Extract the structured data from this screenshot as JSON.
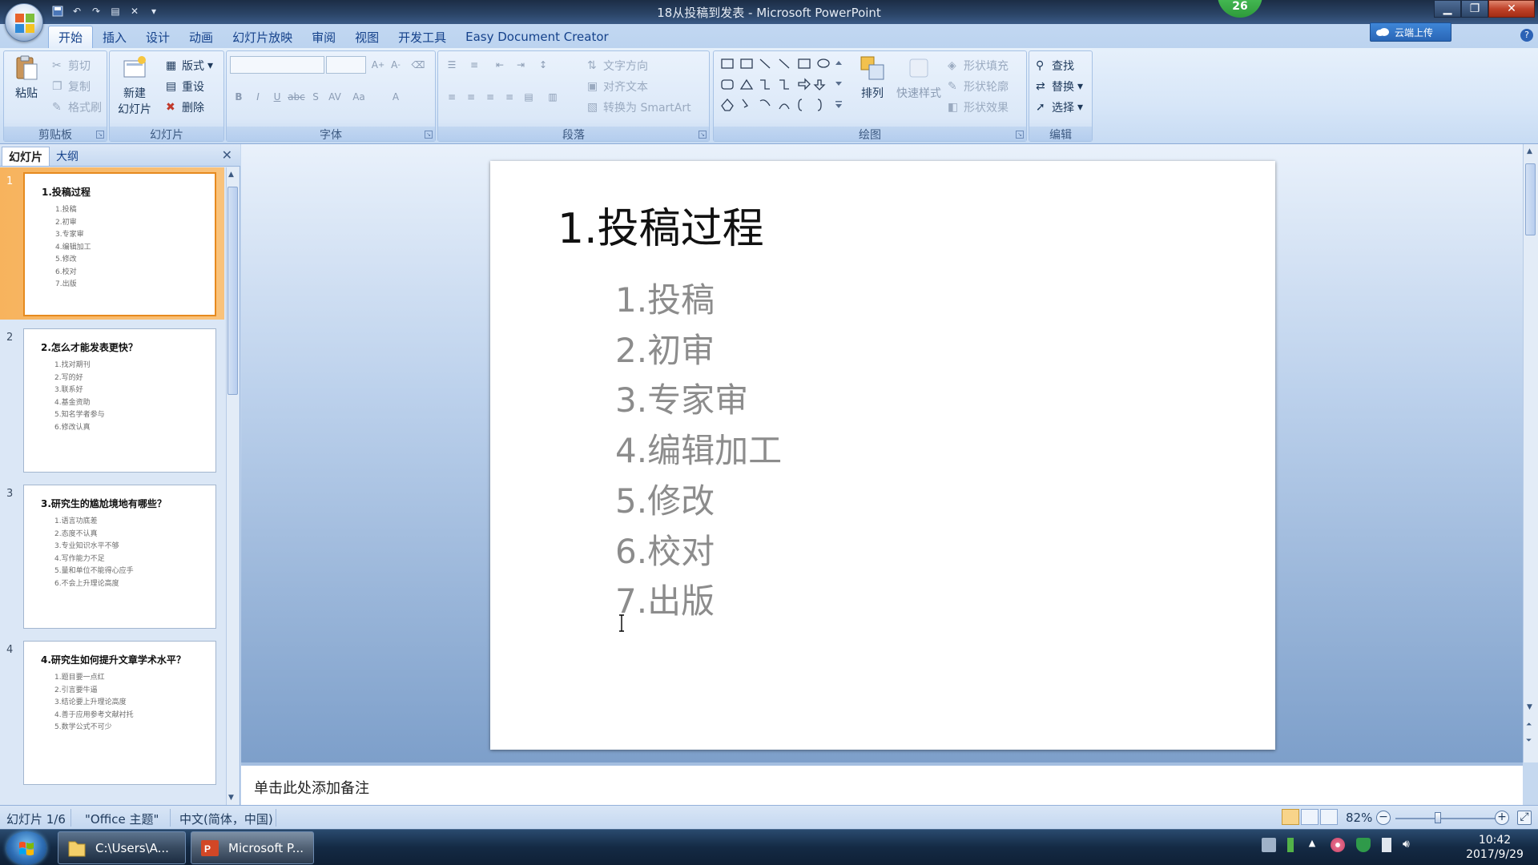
{
  "window": {
    "title": "18从投稿到发表 - Microsoft PowerPoint",
    "badge": "26"
  },
  "ribbon": {
    "tabs": [
      "开始",
      "插入",
      "设计",
      "动画",
      "幻灯片放映",
      "审阅",
      "视图",
      "开发工具",
      "Easy Document Creator"
    ],
    "active_tab": "开始",
    "cloud_upload": "云端上传",
    "clipboard": {
      "label": "剪贴板",
      "paste": "粘贴",
      "cut": "剪切",
      "copy": "复制",
      "format_painter": "格式刷"
    },
    "slides": {
      "label": "幻灯片",
      "new_slide_l1": "新建",
      "new_slide_l2": "幻灯片",
      "layout": "版式",
      "reset": "重设",
      "delete": "删除"
    },
    "font": {
      "label": "字体"
    },
    "paragraph": {
      "label": "段落",
      "text_direction": "文字方向",
      "align_text": "对齐文本",
      "smartart": "转换为 SmartArt"
    },
    "drawing": {
      "label": "绘图",
      "arrange": "排列",
      "quick_styles": "快速样式",
      "shape_fill": "形状填充",
      "shape_outline": "形状轮廓",
      "shape_effects": "形状效果"
    },
    "editing": {
      "label": "编辑",
      "find": "查找",
      "replace": "替换",
      "select": "选择"
    }
  },
  "left_pane": {
    "tabs": [
      "幻灯片",
      "大纲"
    ],
    "active_tab": "幻灯片",
    "thumbnails": [
      {
        "number": "1",
        "title": "1.投稿过程",
        "items": [
          "1.投稿",
          "2.初审",
          "3.专家审",
          "4.编辑加工",
          "5.修改",
          "6.校对",
          "7.出版"
        ]
      },
      {
        "number": "2",
        "title": "2.怎么才能发表更快？",
        "items": [
          "1.找对期刊",
          "2.写的好",
          "3.联系好",
          "4.基金资助",
          "5.知名学者参与",
          "6.修改认真"
        ]
      },
      {
        "number": "3",
        "title": "3.研究生的尴尬境地有哪些？",
        "items": [
          "1.语言功底差",
          "2.态度不认真",
          "3.专业知识水平不够",
          "4.写作能力不足",
          "5.量和单位不能得心应手",
          "6.不会上升理论高度"
        ]
      },
      {
        "number": "4",
        "title": "4.研究生如何提升文章学术水平？",
        "items": [
          "1.题目要一点红",
          "2.引言要牛逼",
          "3.结论要上升理论高度",
          "4.善于应用参考文献衬托",
          "5.数学公式不可少"
        ]
      }
    ]
  },
  "slide": {
    "title": "1.投稿过程",
    "items": [
      "1.投稿",
      "2.初审",
      "3.专家审",
      "4.编辑加工",
      "5.修改",
      "6.校对",
      "7.出版"
    ]
  },
  "notes": {
    "placeholder": "单击此处添加备注"
  },
  "status": {
    "slide_counter": "幻灯片 1/6",
    "theme": "\"Office 主题\"",
    "language": "中文(简体，中国)",
    "zoom": "82%",
    "zoom_fraction": 0.41
  },
  "taskbar": {
    "items": [
      "C:\\Users\\A...",
      "Microsoft P..."
    ],
    "time": "10:42",
    "date": "2017/9/29"
  }
}
